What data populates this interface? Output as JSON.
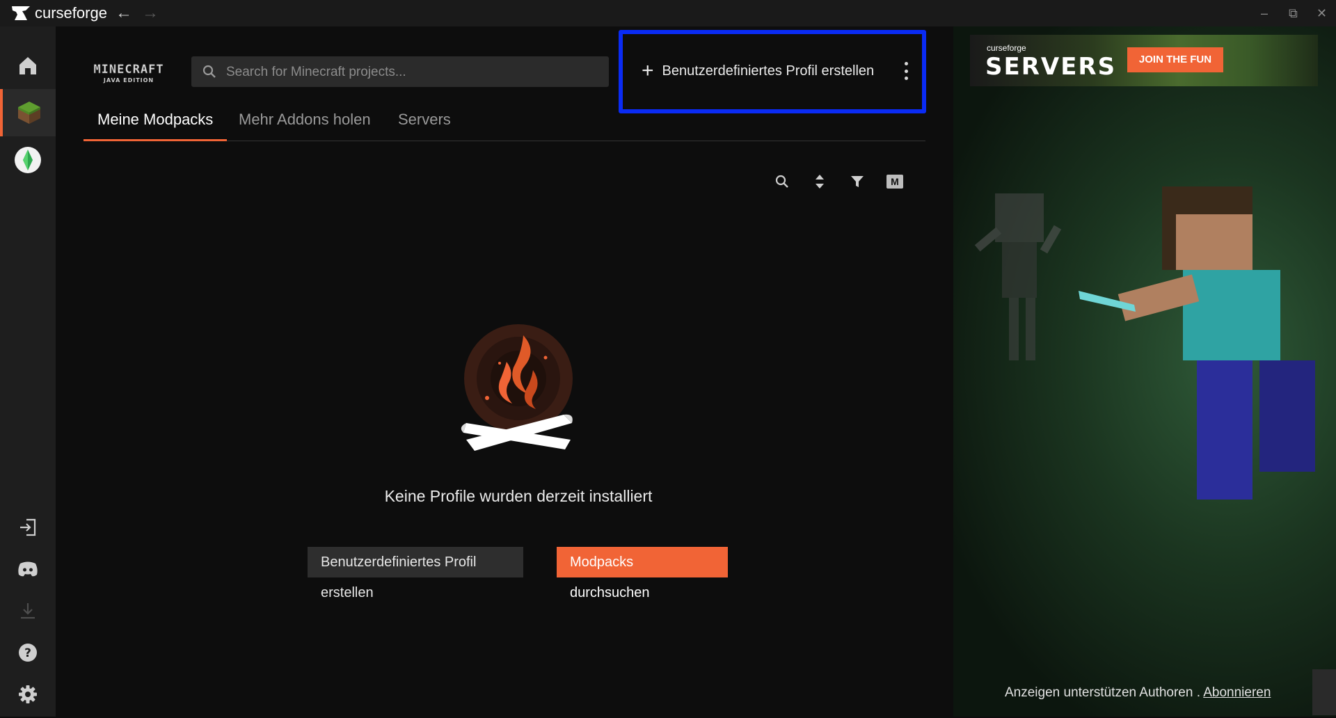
{
  "app": {
    "brand": "curseforge"
  },
  "titlebar": {
    "back": "←",
    "forward": "→",
    "minimize": "–",
    "restore": "⧉",
    "close": "✕"
  },
  "game": {
    "logo_line1": "MINECRAFT",
    "logo_line2": "JAVA EDITION"
  },
  "search": {
    "placeholder": "Search for Minecraft projects..."
  },
  "header": {
    "create_label": "Benutzerdefiniertes Profil erstellen",
    "plus": "+"
  },
  "tabs": [
    {
      "label": "Meine Modpacks",
      "active": true
    },
    {
      "label": "Mehr Addons holen",
      "active": false
    },
    {
      "label": "Servers",
      "active": false
    }
  ],
  "toolbar": {
    "m_label": "M"
  },
  "empty": {
    "message": "Keine Profile wurden derzeit installiert",
    "create_button": "Benutzerdefiniertes Profil erstellen",
    "browse_button": "Modpacks durchsuchen"
  },
  "ad": {
    "brand": "curseforge",
    "title": "SERVERS",
    "cta": "JOIN THE FUN",
    "footer_text": "Anzeigen unterstützen Authoren . ",
    "footer_link": "Abonnieren"
  },
  "colors": {
    "accent": "#f16436",
    "highlight": "#0a2bf4",
    "sidebar": "#1e1e1e",
    "background": "#0d0d0d"
  }
}
